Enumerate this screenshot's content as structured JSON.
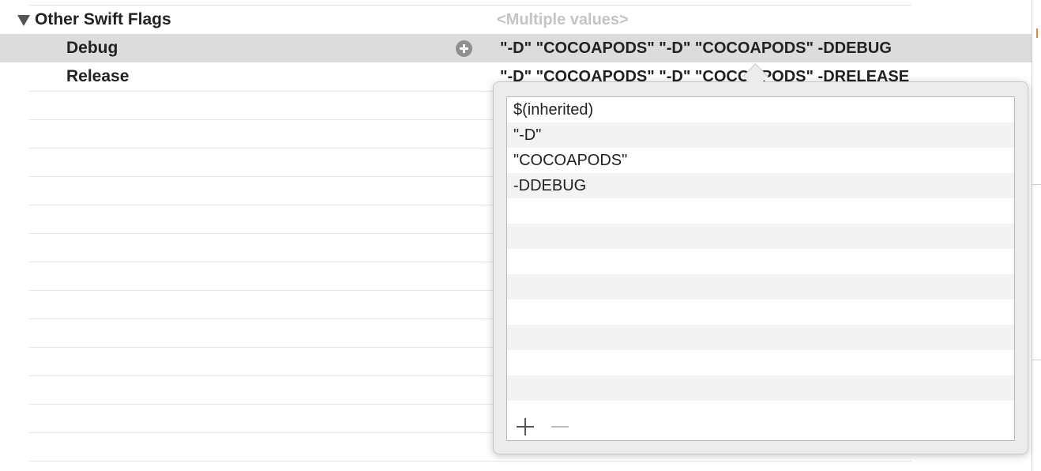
{
  "setting": {
    "title": "Other Swift Flags",
    "value": "<Multiple values>"
  },
  "rows": [
    {
      "label": "Debug",
      "value": "\"-D\" \"COCOAPODS\" \"-D\" \"COCOAPODS\" -DDEBUG"
    },
    {
      "label": "Release",
      "value": "\"-D\" \"COCOAPODS\" \"-D\" \"COCOAPODS\" -DRELEASE"
    }
  ],
  "popover": {
    "items": [
      "$(inherited)",
      "\"-D\"",
      "\"COCOAPODS\"",
      "-DDEBUG"
    ],
    "add_icon": "plus-icon",
    "remove_icon": "minus-icon"
  },
  "colors": {
    "selected_row": "#dcdcdc",
    "placeholder_text": "#c4c4c4",
    "edge_accent": "#e8873a"
  }
}
